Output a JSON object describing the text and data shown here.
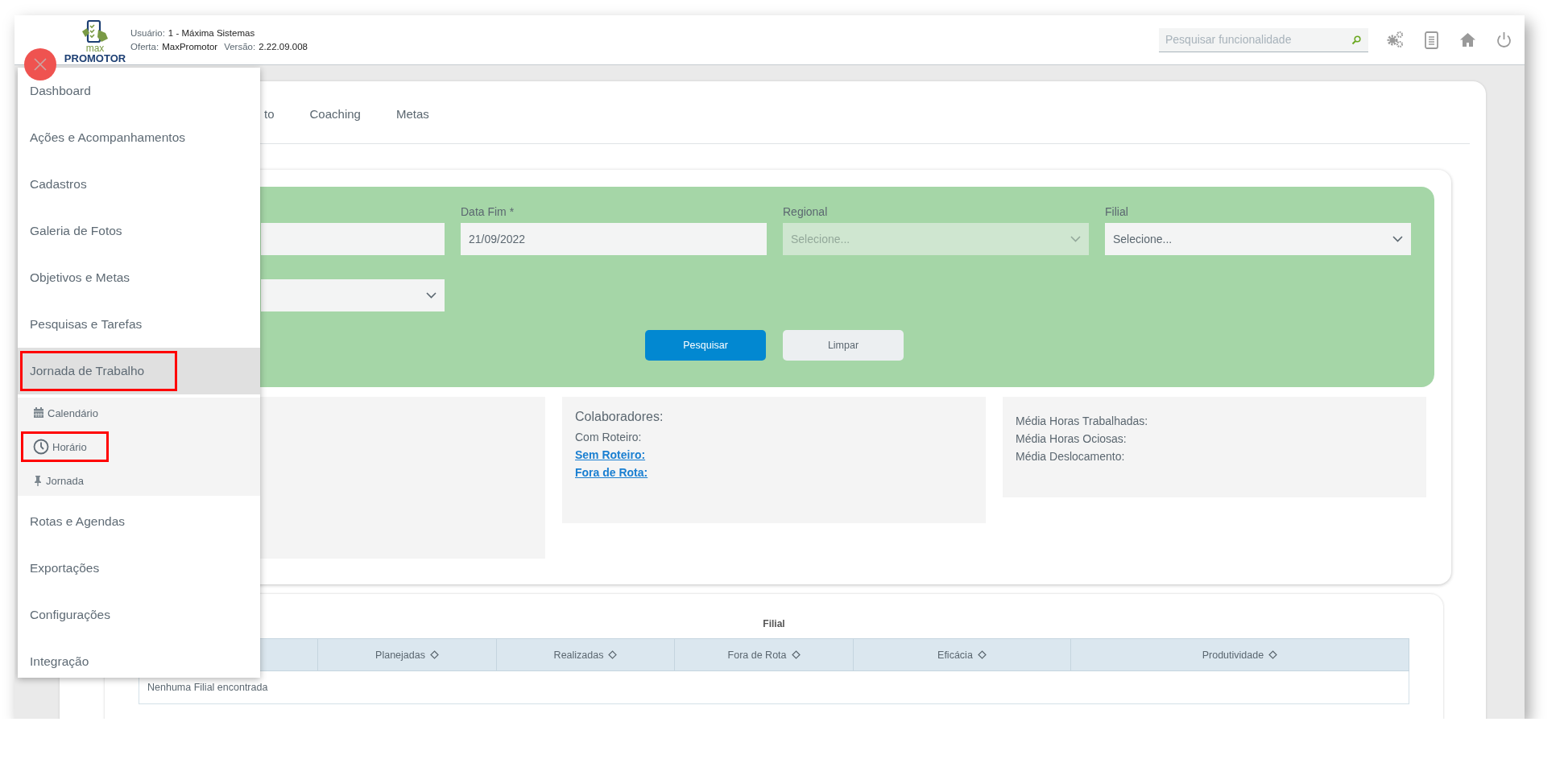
{
  "header": {
    "logo": {
      "line1": "max",
      "line2": "PROMOTOR"
    },
    "user_label": "Usuário:",
    "user_value": "1 - Máxima Sistemas",
    "offer_label": "Oferta:",
    "offer_value": "MaxPromotor",
    "version_label": "Versão:",
    "version_value": "2.22.09.008",
    "search": {
      "placeholder": "Pesquisar funcionalidade"
    }
  },
  "sidebar": {
    "items": [
      {
        "label": "Dashboard",
        "selected": false,
        "highlighted": false
      },
      {
        "label": "Ações e Acompanhamentos",
        "selected": false,
        "highlighted": false
      },
      {
        "label": "Cadastros",
        "selected": false,
        "highlighted": false
      },
      {
        "label": "Galeria de Fotos",
        "selected": false,
        "highlighted": false
      },
      {
        "label": "Objetivos e Metas",
        "selected": false,
        "highlighted": false
      },
      {
        "label": "Pesquisas e Tarefas",
        "selected": false,
        "highlighted": false
      },
      {
        "label": "Jornada de Trabalho",
        "selected": true,
        "highlighted": true,
        "children": [
          {
            "label": "Calendário",
            "highlighted": false
          },
          {
            "label": "Horário",
            "highlighted": true
          },
          {
            "label": "Jornada",
            "highlighted": false
          }
        ]
      },
      {
        "label": "Rotas e Agendas",
        "selected": false,
        "highlighted": false
      },
      {
        "label": "Exportações",
        "selected": false,
        "highlighted": false
      },
      {
        "label": "Configurações",
        "selected": false,
        "highlighted": false
      },
      {
        "label": "Integração",
        "selected": false,
        "highlighted": false
      }
    ]
  },
  "tabs": [
    {
      "label": "to"
    },
    {
      "label": "Coaching"
    },
    {
      "label": "Metas"
    }
  ],
  "filters": {
    "fields": [
      {
        "kind": "input",
        "disabled": false
      },
      {
        "kind": "input",
        "label": "Data Fim *",
        "value": "21/09/2022",
        "disabled": false
      },
      {
        "kind": "select",
        "label": "Regional",
        "placeholder": "Selecione...",
        "disabled": true
      },
      {
        "kind": "select",
        "label": "Filial",
        "placeholder": "Selecione...",
        "disabled": false
      },
      {
        "kind": "select",
        "disabled": false
      }
    ],
    "buttons": [
      {
        "label": "Pesquisar",
        "kind": "primary"
      },
      {
        "label": "Limpar",
        "kind": "secondary"
      }
    ]
  },
  "stats": [
    {
      "kind": "blank"
    },
    {
      "kind": "lines",
      "lines": [
        {
          "kind": "heading",
          "text": "Colaboradores:"
        },
        {
          "kind": "text",
          "text": "Com Roteiro:"
        },
        {
          "kind": "link",
          "text": "Sem Roteiro:"
        },
        {
          "kind": "link",
          "text": "Fora de Rota:"
        }
      ]
    },
    {
      "kind": "lines",
      "lines": [
        {
          "kind": "text",
          "text": "Média Horas Trabalhadas:"
        },
        {
          "kind": "text",
          "text": "Média Horas Ociosas:"
        },
        {
          "kind": "text",
          "text": "Média Deslocamento:"
        }
      ]
    }
  ],
  "table": {
    "title": "Filial",
    "columns": [
      "Planejadas",
      "Realizadas",
      "Fora de Rota",
      "Eficácia",
      "Produtividade"
    ],
    "empty_message": "Nenhuma Filial encontrada"
  }
}
